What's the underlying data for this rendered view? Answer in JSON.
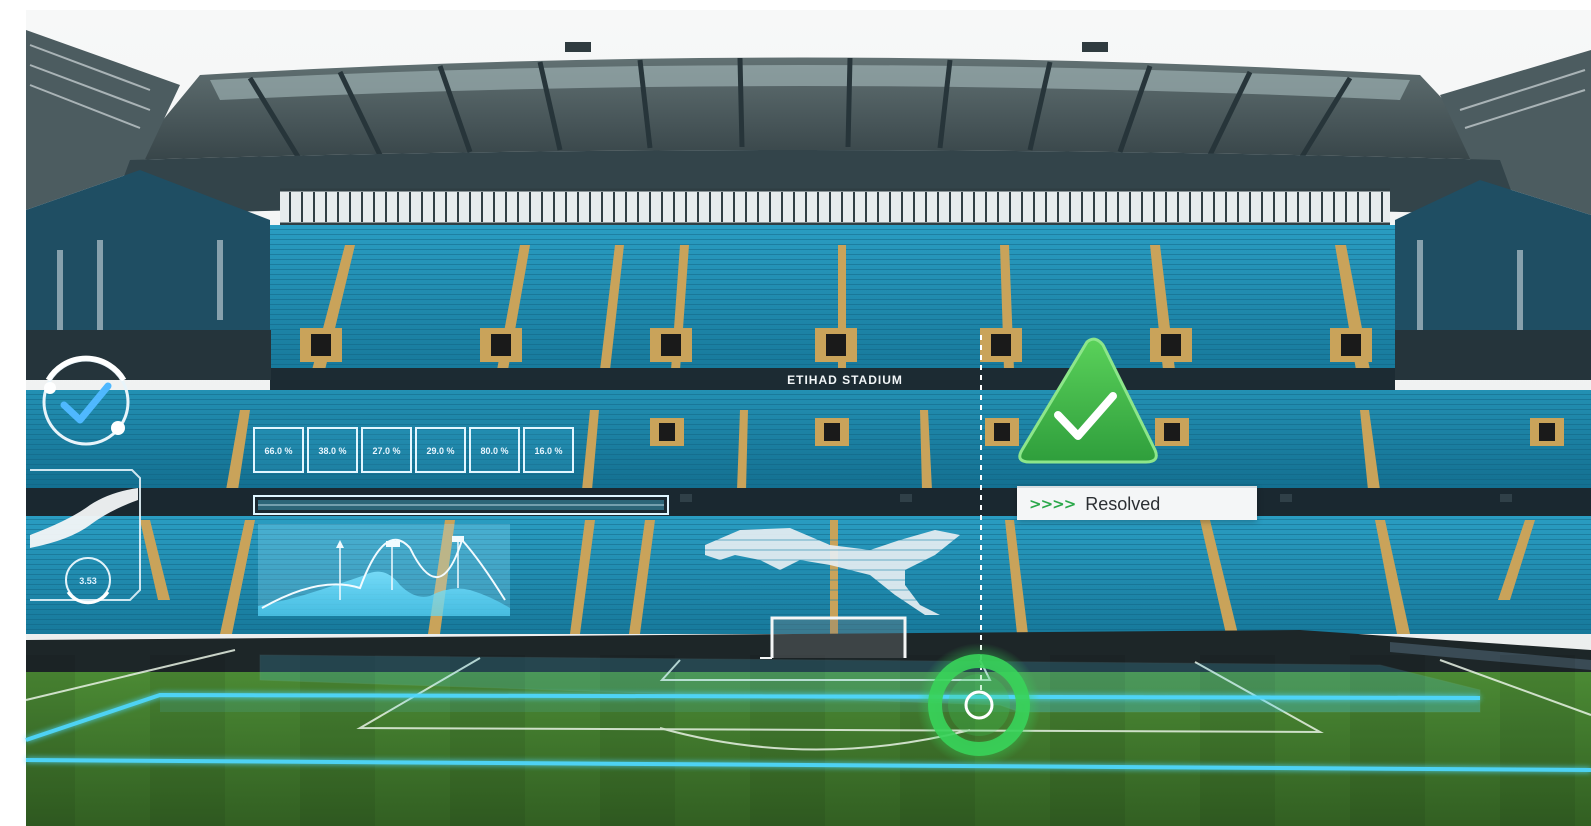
{
  "scene": {
    "stadium_banner": "ETIHAD STADIUM"
  },
  "hud": {
    "gauge_value": "3.53",
    "percentages": [
      "66.0 %",
      "38.0 %",
      "27.0 %",
      "29.0 %",
      "80.0 %",
      "16.0 %"
    ]
  },
  "status": {
    "chevrons": ">>>>",
    "label": "Resolved"
  },
  "icons": {
    "check_badge": "check-triangle-icon",
    "gauge_check": "gauge-check-icon",
    "target": "target-ring-icon"
  },
  "colors": {
    "seat_blue": "#1f8fb3",
    "pitch_green": "#3f7d2c",
    "hud_cyan": "#4fd8ff",
    "success_green": "#3dbb4a",
    "roof_steel": "#3c4c50"
  }
}
